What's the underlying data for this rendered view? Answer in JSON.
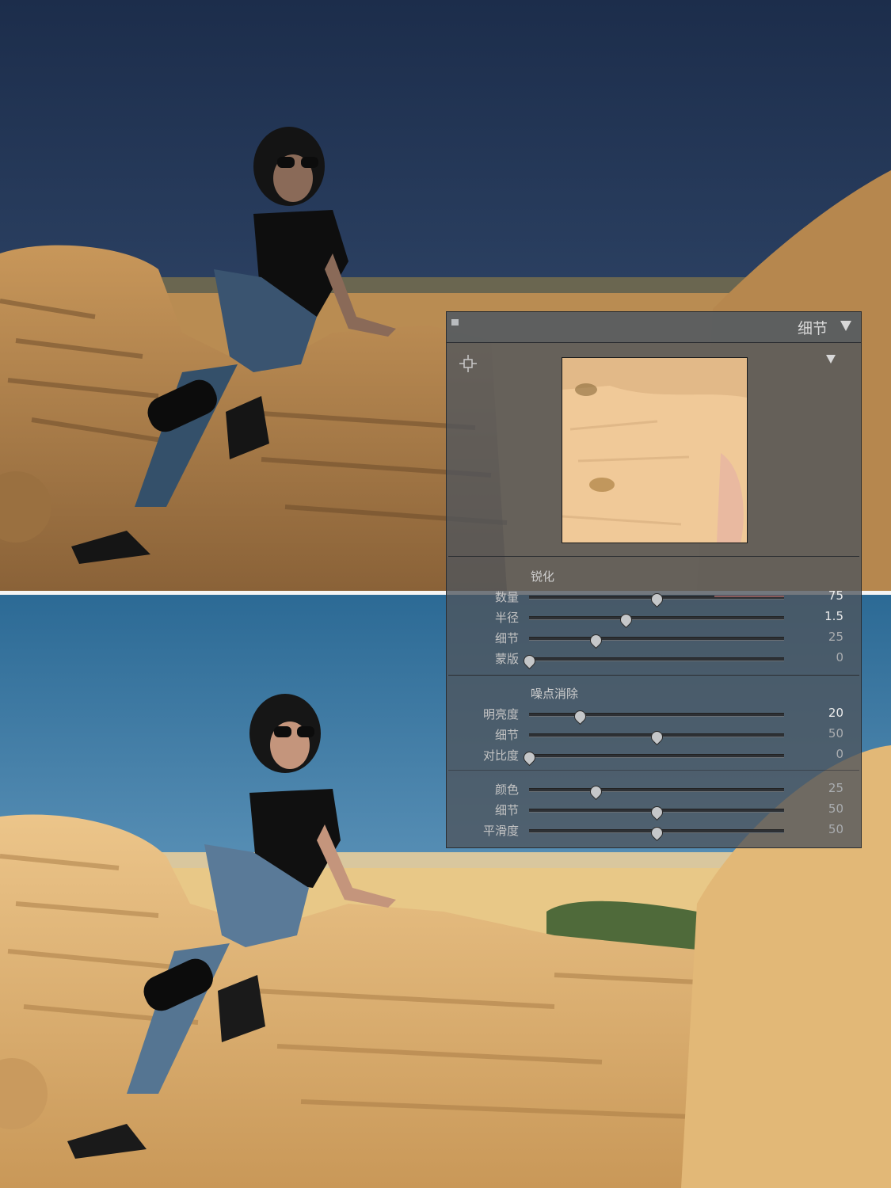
{
  "panel": {
    "title": "细节",
    "sharpening": {
      "title": "锐化",
      "sliders": [
        {
          "label": "数量",
          "value": "75",
          "fraction": 0.5
        },
        {
          "label": "半径",
          "value": "1.5",
          "fraction": 0.38
        },
        {
          "label": "细节",
          "value": "25",
          "fraction": 0.26
        },
        {
          "label": "蒙版",
          "value": "0",
          "fraction": 0.0
        }
      ]
    },
    "noise_reduction": {
      "title": "噪点消除",
      "luminance": [
        {
          "label": "明亮度",
          "value": "20",
          "fraction": 0.2
        },
        {
          "label": "细节",
          "value": "50",
          "fraction": 0.5
        },
        {
          "label": "对比度",
          "value": "0",
          "fraction": 0.0
        }
      ],
      "color": [
        {
          "label": "颜色",
          "value": "25",
          "fraction": 0.26
        },
        {
          "label": "细节",
          "value": "50",
          "fraction": 0.5
        },
        {
          "label": "平滑度",
          "value": "50",
          "fraction": 0.5
        }
      ]
    }
  },
  "icons": {
    "collapse": "collapse-square-icon",
    "title_arrow": "triangle-down-icon",
    "target": "target-crosshair-icon",
    "preview_arrow": "triangle-down-icon"
  },
  "colors": {
    "panel_bg": "#4e545c",
    "sky_before": "#1d3150",
    "sky_after": "#2f6e98",
    "rock": "#d8ad68"
  }
}
